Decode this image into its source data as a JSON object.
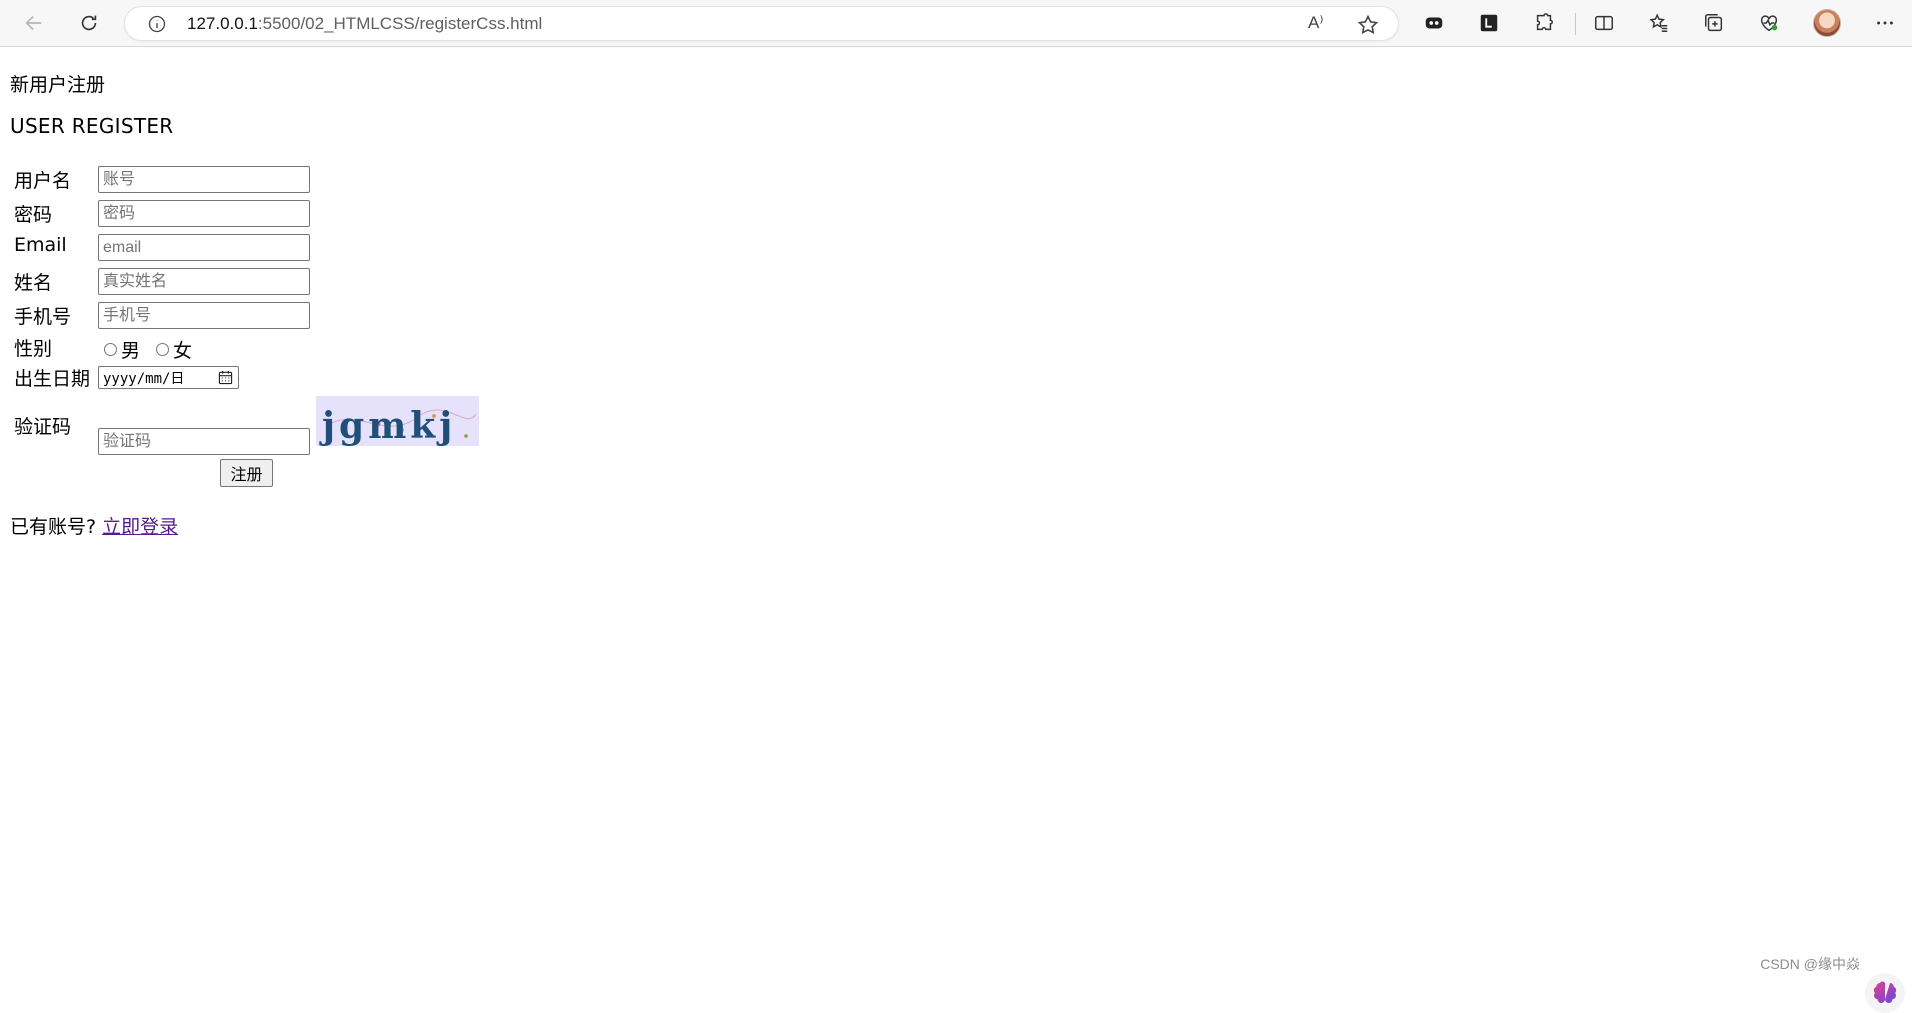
{
  "browser": {
    "url_host": "127.0.0.1",
    "url_path": ":5500/02_HTMLCSS/registerCss.html",
    "read_aloud_glyph": "A⁾"
  },
  "page": {
    "heading_cn": "新用户注册",
    "heading_en": "USER REGISTER",
    "form": {
      "username_label": "用户名",
      "username_placeholder": "账号",
      "password_label": "密码",
      "password_placeholder": "密码",
      "email_label": "Email",
      "email_placeholder": "email",
      "name_label": "姓名",
      "name_placeholder": "真实姓名",
      "phone_label": "手机号",
      "phone_placeholder": "手机号",
      "gender_label": "性别",
      "gender_male": "男",
      "gender_female": "女",
      "birthday_label": "出生日期",
      "birthday_value": "yyyy/mm/日",
      "captcha_label": "验证码",
      "captcha_placeholder": "验证码",
      "captcha_text": "jgmkj",
      "submit_label": "注册"
    },
    "footer": {
      "prompt": "已有账号?",
      "login_link": "立即登录"
    },
    "watermark": "CSDN @缘中焱"
  }
}
